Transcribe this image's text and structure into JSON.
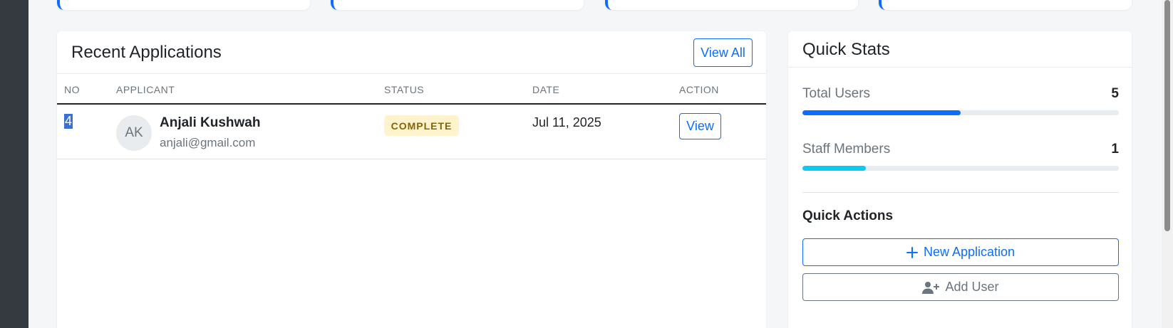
{
  "recent": {
    "title": "Recent Applications",
    "view_all_label": "View All",
    "columns": [
      "NO",
      "APPLICANT",
      "STATUS",
      "DATE",
      "ACTION"
    ],
    "rows": [
      {
        "no": "4",
        "initials": "AK",
        "name": "Anjali Kushwah",
        "email": "anjali@gmail.com",
        "status": "COMPLETE",
        "date": "Jul 11, 2025",
        "action": "View"
      }
    ]
  },
  "quick_stats": {
    "title": "Quick Stats",
    "stats": [
      {
        "label": "Total Users",
        "value": "5",
        "fraction": 0.5,
        "color": "#0d6efd"
      },
      {
        "label": "Staff Members",
        "value": "1",
        "fraction": 0.2,
        "color": "#0dcaf0"
      }
    ],
    "actions_title": "Quick Actions",
    "new_application_label": "New Application",
    "add_user_label": "Add User"
  },
  "colors": {
    "primary": "#0d6efd",
    "info": "#0dcaf0",
    "warning_bg": "#fff3cd",
    "sidebar": "#343a40"
  }
}
